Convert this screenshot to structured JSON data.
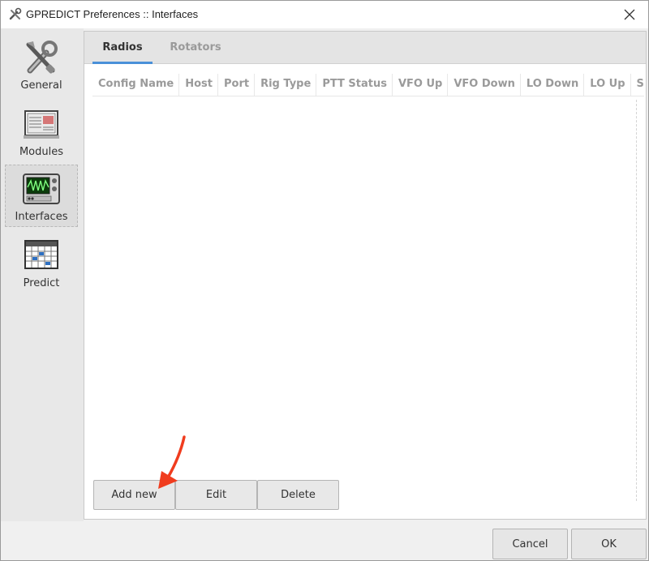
{
  "window": {
    "title": "GPREDICT Preferences :: Interfaces"
  },
  "sidebar": {
    "items": [
      {
        "label": "General",
        "icon": "tools-icon"
      },
      {
        "label": "Modules",
        "icon": "modules-icon"
      },
      {
        "label": "Interfaces",
        "icon": "interfaces-icon",
        "selected": true
      },
      {
        "label": "Predict",
        "icon": "calendar-icon"
      }
    ]
  },
  "tabs": [
    {
      "label": "Radios",
      "active": true
    },
    {
      "label": "Rotators",
      "active": false
    }
  ],
  "table": {
    "columns": [
      "Config Name",
      "Host",
      "Port",
      "Rig Type",
      "PTT Status",
      "VFO Up",
      "VFO Down",
      "LO Down",
      "LO Up",
      "Sign"
    ],
    "rows": []
  },
  "actions": {
    "add_label": "Add new",
    "edit_label": "Edit",
    "delete_label": "Delete"
  },
  "dialog": {
    "cancel_label": "Cancel",
    "ok_label": "OK"
  },
  "colors": {
    "accent": "#4a90d9",
    "annotation_arrow": "#f03c1e"
  }
}
